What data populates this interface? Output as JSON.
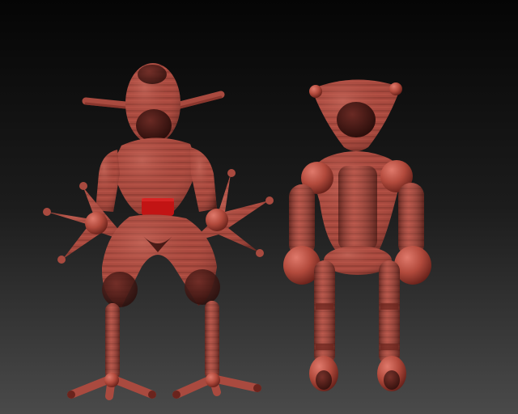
{
  "viewport": {
    "background": {
      "top_color": "#050505",
      "mid_color": "#1c1c1c",
      "bottom_color": "#4a4a4a"
    }
  },
  "models": {
    "material": {
      "base_color": "#a94a3f",
      "band_dark_color": "#7a2f28",
      "highlight_color": "#c8675a",
      "shadow_color": "#3c1512",
      "accent_red": "#c21414"
    },
    "left_figure": {
      "name_icon": "sculpt-figure-antenna-starhands"
    },
    "right_figure": {
      "name_icon": "sculpt-figure-triangle-head"
    }
  }
}
